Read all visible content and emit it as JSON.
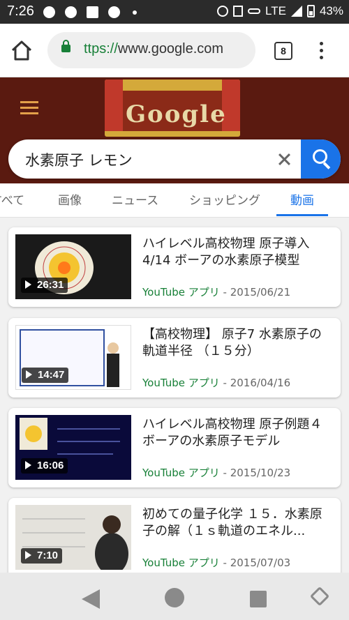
{
  "status_bar": {
    "time": "7:26",
    "network": "LTE",
    "battery": "43%"
  },
  "browser": {
    "url_scheme": "ttps://",
    "url_host": "www.google.com",
    "tab_count": "8"
  },
  "search": {
    "query": "水素原子 レモン"
  },
  "tabs": [
    {
      "label": "すべて"
    },
    {
      "label": "画像"
    },
    {
      "label": "ニュース"
    },
    {
      "label": "ショッピング"
    },
    {
      "label": "動画"
    }
  ],
  "results": [
    {
      "title": "ハイレベル高校物理 原子導入 4/14 ボーアの水素原子模型",
      "source": "YouTube アプリ",
      "date": " - 2015/06/21",
      "duration": "26:31"
    },
    {
      "title": "【高校物理】 原子7 水素原子の軌道半径 （１５分）",
      "source": "YouTube アプリ",
      "date": " - 2016/04/16",
      "duration": "14:47"
    },
    {
      "title": "ハイレベル高校物理 原子例題４ ボーアの水素原子モデル",
      "source": "YouTube アプリ",
      "date": " - 2015/10/23",
      "duration": "16:06"
    },
    {
      "title": "初めての量子化学 １５．水素原子の解（１ｓ軌道のエネル...",
      "source": "YouTube アプリ",
      "date": " - 2015/07/03",
      "duration": "7:10"
    }
  ],
  "colors": {
    "accent": "#1a73e8",
    "source_green": "#188038",
    "header_bg": "#5a1a10"
  }
}
